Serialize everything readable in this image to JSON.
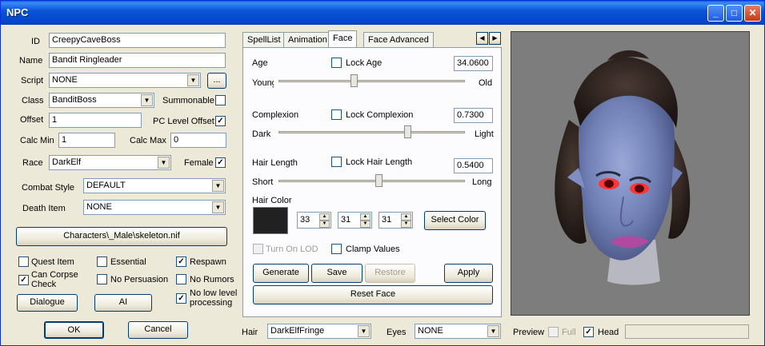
{
  "window": {
    "title": "NPC"
  },
  "left": {
    "id_label": "ID",
    "id_value": "CreepyCaveBoss",
    "name_label": "Name",
    "name_value": "Bandit Ringleader",
    "script_label": "Script",
    "script_value": "NONE",
    "script_browse": "...",
    "class_label": "Class",
    "class_value": "BanditBoss",
    "summonable_label": "Summonable",
    "summonable_checked": false,
    "offset_label": "Offset",
    "offset_value": "1",
    "pc_level_offset_label": "PC Level Offset",
    "pc_level_offset_checked": true,
    "calc_min_label": "Calc Min",
    "calc_min_value": "1",
    "calc_max_label": "Calc Max",
    "calc_max_value": "0",
    "race_label": "Race",
    "race_value": "DarkElf",
    "female_label": "Female",
    "female_checked": true,
    "combat_style_label": "Combat Style",
    "combat_style_value": "DEFAULT",
    "death_item_label": "Death Item",
    "death_item_value": "NONE",
    "skeleton_button": "Characters\\_Male\\skeleton.nif",
    "checks": {
      "quest_item": "Quest Item",
      "essential": "Essential",
      "respawn": "Respawn",
      "can_corpse_check": "Can Corpse Check",
      "no_persuasion": "No Persuasion",
      "no_rumors": "No Rumors",
      "no_low_level": "No low level processing"
    },
    "dialogue_button": "Dialogue",
    "ai_button": "AI",
    "ok_button": "OK",
    "cancel_button": "Cancel"
  },
  "tabs": [
    "SpellList",
    "Animation",
    "Face",
    "Face Advanced"
  ],
  "active_tab": "Face",
  "face": {
    "age_label": "Age",
    "lock_age_label": "Lock Age",
    "age_value": "34.0600",
    "age_min_label": "Young",
    "age_max_label": "Old",
    "age_level": 0.4,
    "complexion_label": "Complexion",
    "lock_complexion_label": "Lock Complexion",
    "complexion_value": "0.7300",
    "complexion_min_label": "Dark",
    "complexion_max_label": "Light",
    "complexion_level": 0.7,
    "hair_length_label": "Hair Length",
    "lock_hair_length_label": "Lock Hair Length",
    "hair_length_value": "0.5400",
    "hair_min_label": "Short",
    "hair_max_label": "Long",
    "hair_level": 0.54,
    "hair_color_label": "Hair Color",
    "hair_color_hex": "#212121",
    "r_value": "33",
    "g_value": "31",
    "b_value": "31",
    "select_color_button": "Select Color",
    "turn_on_lod_label": "Turn On LOD",
    "clamp_values_label": "Clamp Values",
    "generate_button": "Generate",
    "save_button": "Save",
    "restore_button": "Restore",
    "apply_button": "Apply",
    "reset_face_button": "Reset Face"
  },
  "bottom": {
    "hair_label": "Hair",
    "hair_value": "DarkElfFringe",
    "eyes_label": "Eyes",
    "eyes_value": "NONE",
    "preview_label": "Preview",
    "full_label": "Full",
    "head_label": "Head",
    "head_checked": true
  }
}
